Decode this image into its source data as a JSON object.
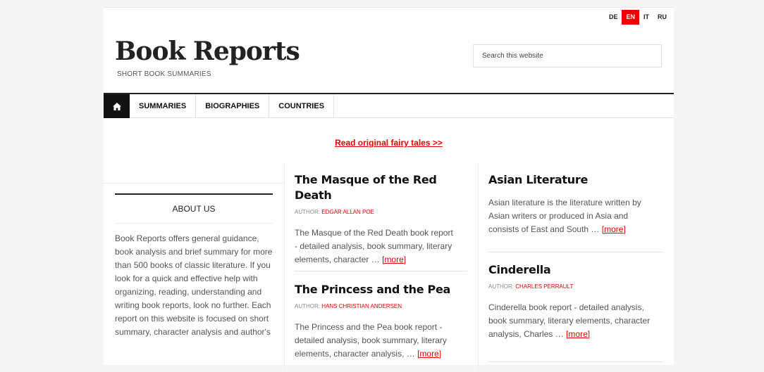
{
  "languages": [
    "DE",
    "EN",
    "IT",
    "RU"
  ],
  "active_language": "EN",
  "site": {
    "title": "Book Reports",
    "description": "SHORT BOOK SUMMARIES"
  },
  "search": {
    "placeholder": "Search this website"
  },
  "nav": {
    "home_icon": "home-icon",
    "items": [
      "SUMMARIES",
      "BIOGRAPHIES",
      "COUNTRIES"
    ]
  },
  "promo": {
    "link": "Read original fairy tales >>"
  },
  "about": {
    "title": "ABOUT US",
    "text": "Book Reports offers general guidance, book analysis and brief summary for more than 500 books of classic literature. If you look for a quick and effective help with organizing, reading, understanding and writing book reports, look no further. Each report on this website is focused on short summary, character analysis and author's"
  },
  "posts_middle": [
    {
      "title": "The Masque of the Red Death",
      "author_label": "AUTHOR:",
      "author": "EDGAR ALLAN POE",
      "excerpt": "The Masque of the Red Death book report - detailed analysis, book summary, literary elements, character …",
      "more": "[more]"
    },
    {
      "title": "The Princess and the Pea",
      "author_label": "AUTHOR:",
      "author": "HANS CHRISTIAN ANDERSEN",
      "excerpt": "The Princess and the Pea book report - detailed analysis, book summary, literary elements, character analysis, …",
      "more": "[more]"
    }
  ],
  "posts_right": [
    {
      "title": "Asian Literature",
      "excerpt": "Asian literature is the literature written by Asian writers or produced in Asia and consists of East and South …",
      "more": "[more]"
    },
    {
      "title": "Cinderella",
      "author_label": "AUTHOR:",
      "author": "CHARLES PERRAULT",
      "excerpt": "Cinderella book report - detailed analysis, book summary, literary elements, character analysis, Charles …",
      "more": "[more]"
    }
  ],
  "colors": {
    "accent": "#ee0000",
    "text": "#222222",
    "muted": "#555555"
  }
}
